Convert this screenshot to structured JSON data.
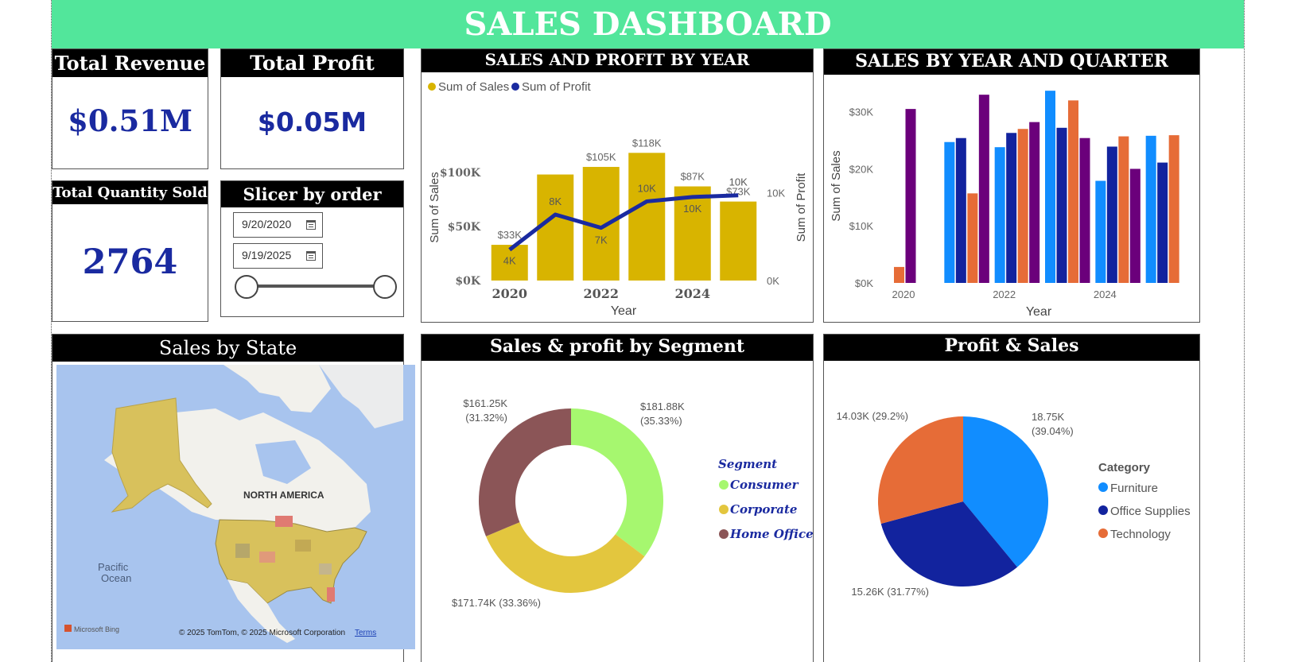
{
  "title": "SALES DASHBOARD",
  "kpis": {
    "revenue": {
      "label": "Total Revenue",
      "value": "$0.51M"
    },
    "profit": {
      "label": "Total Profit",
      "value": "$0.05M"
    },
    "quantity": {
      "label": "Total Quantity Sold",
      "value": "2764"
    }
  },
  "slicer": {
    "label": "Slicer by order date",
    "start": "9/20/2020",
    "end": "9/19/2025",
    "range_fraction": [
      0,
      1
    ]
  },
  "colors": {
    "header_green": "#52e69b",
    "kpi_blue": "#1a2aa0",
    "sales_gold": "#d8b400",
    "profit_navy": "#1a2aa0",
    "q1": "#118dff",
    "q2": "#12239e",
    "q3": "#e66c37",
    "q4": "#6b007b",
    "consumer": "#a6f76f",
    "corporate": "#e3c63e",
    "home_office": "#8b5557",
    "furniture": "#118dff",
    "office_supplies": "#12239e",
    "technology": "#e66c37"
  },
  "map": {
    "title": "Sales by State",
    "region_label": "NORTH AMERICA",
    "ocean_label_1": "Pacific",
    "ocean_label_2": "Ocean",
    "attribution": "© 2025 TomTom, © 2025 Microsoft Corporation",
    "terms": "Terms",
    "brand": "Microsoft Bing"
  },
  "chart_data": [
    {
      "type": "bar",
      "title": "SALES AND PROFIT BY YEAR",
      "xlabel": "Year",
      "ylabel": "Sum of Sales",
      "y2label": "Sum of Profit",
      "legend_position": "top-left",
      "categories": [
        "2020",
        "2021",
        "2022",
        "2023",
        "2024",
        "2025"
      ],
      "x_tick_labels": [
        "2020",
        "",
        "2022",
        "",
        "2024",
        ""
      ],
      "y_ticks": [
        "$0K",
        "$50K",
        "$100K"
      ],
      "y2_ticks": [
        "0K",
        "10K"
      ],
      "ylim": [
        0,
        130000
      ],
      "y2lim": [
        0,
        16000
      ],
      "series": [
        {
          "name": "Sum of Sales",
          "kind": "bar",
          "values": [
            33000,
            98000,
            105000,
            118000,
            87000,
            73000
          ],
          "labels": [
            "$33K",
            "",
            "$105K",
            "$118K",
            "$87K",
            "$73K"
          ]
        },
        {
          "name": "Sum of Profit",
          "kind": "line",
          "values": [
            3500,
            7500,
            6000,
            9000,
            9500,
            9700
          ],
          "labels": [
            "4K",
            "8K",
            "7K",
            "10K",
            "10K",
            "10K"
          ]
        }
      ]
    },
    {
      "type": "bar",
      "title": "SALES BY YEAR AND QUARTER",
      "xlabel": "Year",
      "ylabel": "Sum of Sales",
      "grid": false,
      "categories": [
        "2020",
        "2021",
        "2022",
        "2023",
        "2024",
        "2025"
      ],
      "x_tick_labels": [
        "2020",
        "",
        "2022",
        "",
        "2024",
        ""
      ],
      "y_ticks": [
        "$0K",
        "$10K",
        "$20K",
        "$30K"
      ],
      "ylim": [
        0,
        33000
      ],
      "series": [
        {
          "name": "Q1",
          "values": [
            null,
            24700,
            23800,
            33700,
            17900,
            25800
          ]
        },
        {
          "name": "Q2",
          "values": [
            null,
            25400,
            26300,
            27200,
            23900,
            21100
          ]
        },
        {
          "name": "Q3",
          "values": [
            2800,
            15700,
            27000,
            32000,
            25700,
            25900
          ]
        },
        {
          "name": "Q4",
          "values": [
            30500,
            33000,
            28200,
            25400,
            20000,
            null
          ]
        }
      ]
    },
    {
      "type": "pie",
      "donut": true,
      "title": "Sales & profit by Segment",
      "legend_title": "Segment",
      "legend_position": "right",
      "labels": [
        "Consumer",
        "Corporate",
        "Home Office"
      ],
      "values": [
        181880,
        171740,
        161250
      ],
      "value_labels": [
        "$181.88K",
        "$171.74K",
        "$161.25K"
      ],
      "percent_labels": [
        "(35.33%)",
        "(33.36%)",
        "(31.32%)"
      ]
    },
    {
      "type": "pie",
      "title": "Profit & Sales",
      "legend_title": "Category",
      "legend_position": "right",
      "labels": [
        "Furniture",
        "Office Supplies",
        "Technology"
      ],
      "values": [
        18750,
        15260,
        14030
      ],
      "value_labels": [
        "18.75K",
        "15.26K",
        "14.03K"
      ],
      "percent_labels": [
        "(39.04%)",
        "(31.77%)",
        "(29.2%)"
      ]
    }
  ]
}
